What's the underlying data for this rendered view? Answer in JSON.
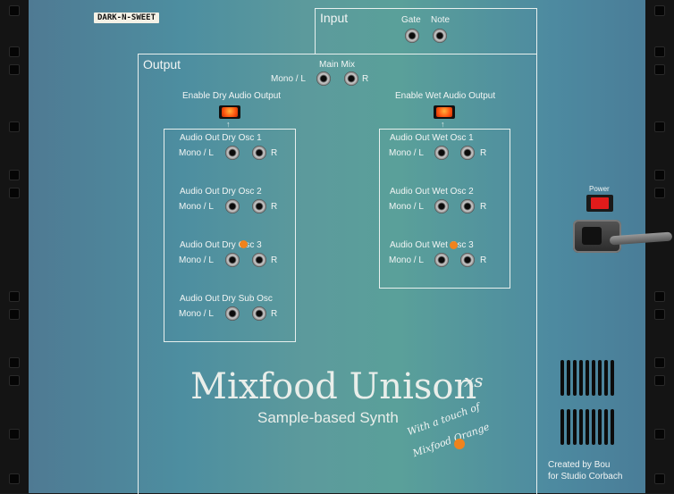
{
  "brand_tag": "DARK-N-SWEET",
  "input_section": {
    "title": "Input",
    "gate_label": "Gate",
    "note_label": "Note"
  },
  "output_section": {
    "title": "Output",
    "main_mix": {
      "label": "Main Mix",
      "mono_label": "Mono / L",
      "r_label": "R"
    },
    "enable_dry_label": "Enable Dry Audio Output",
    "enable_wet_label": "Enable Wet Audio Output",
    "dry_outputs": [
      {
        "label": "Audio Out Dry Osc 1",
        "mono_label": "Mono / L",
        "r_label": "R"
      },
      {
        "label": "Audio Out Dry Osc 2",
        "mono_label": "Mono / L",
        "r_label": "R"
      },
      {
        "label": "Audio Out Dry Osc 3",
        "mono_label": "Mono / L",
        "r_label": "R"
      },
      {
        "label": "Audio Out Dry Sub Osc",
        "mono_label": "Mono / L",
        "r_label": "R"
      }
    ],
    "wet_outputs": [
      {
        "label": "Audio Out Wet Osc 1",
        "mono_label": "Mono / L",
        "r_label": "R"
      },
      {
        "label": "Audio Out Wet Osc 2",
        "mono_label": "Mono / L",
        "r_label": "R"
      },
      {
        "label": "Audio Out Wet Osc 3",
        "mono_label": "Mono / L",
        "r_label": "R"
      }
    ]
  },
  "power_label": "Power",
  "logo": {
    "title": "Mixfood Unison",
    "superscript": "xs",
    "subtitle": "Sample-based Synth"
  },
  "tagline": {
    "line1": "With a touch of",
    "line2": "Mixfood Orange"
  },
  "credits": {
    "line1": "Created by Bou",
    "line2": "for Studio Corbach"
  },
  "colors": {
    "panel_teal": "#5aa09a",
    "panel_blue": "#4f7a93",
    "button_orange": "#ff5a12",
    "power_red": "#e01b1b",
    "dot_orange": "#f0831d"
  }
}
